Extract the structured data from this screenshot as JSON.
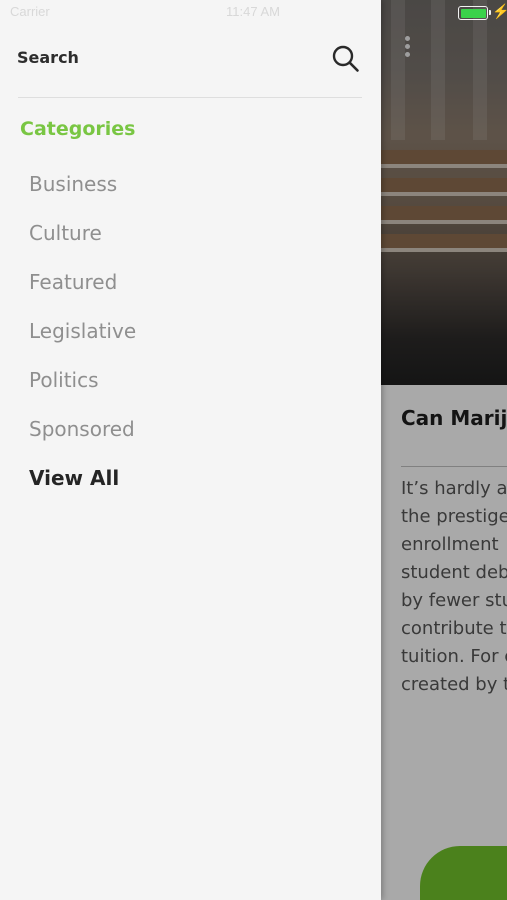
{
  "status_bar": {
    "carrier": "Carrier",
    "time": "11:47 AM"
  },
  "background_article": {
    "headline": "Can Mariju",
    "body_lines": [
      "It’s hardly a",
      "the prestige",
      "enrollment",
      "student deb",
      "by fewer stu",
      "contribute t",
      "tuition. For c",
      "created by t"
    ],
    "accent_color": "#6fbf2a"
  },
  "drawer": {
    "search_label": "Search",
    "search_icon": "search-icon",
    "categories_heading": "Categories",
    "heading_color": "#79c643",
    "categories": [
      {
        "label": "Business"
      },
      {
        "label": "Culture"
      },
      {
        "label": "Featured"
      },
      {
        "label": "Legislative"
      },
      {
        "label": "Politics"
      },
      {
        "label": "Sponsored"
      }
    ],
    "view_all_label": "View All"
  }
}
